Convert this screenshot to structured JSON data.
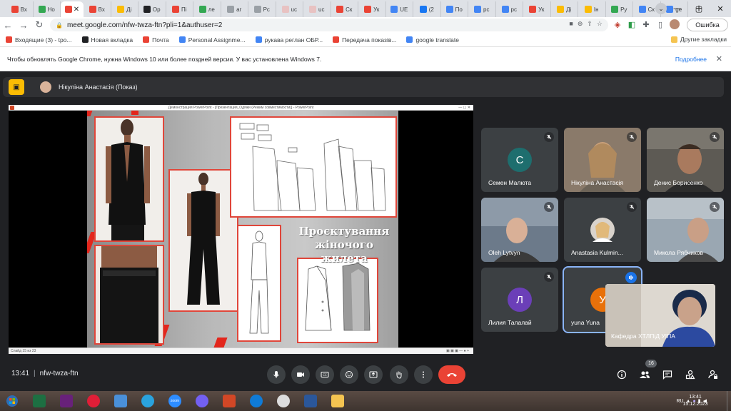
{
  "browser": {
    "tabs": [
      {
        "name": "gmail",
        "label": "Вх",
        "color": "#ea4335"
      },
      {
        "name": "ext",
        "label": "Но",
        "color": "#34a853"
      },
      {
        "name": "meet",
        "label": "",
        "color": "#ea4335",
        "active": true
      },
      {
        "name": "gmail2",
        "label": "Вх",
        "color": "#ea4335"
      },
      {
        "name": "gallery",
        "label": "Ді",
        "color": "#fbbc04"
      },
      {
        "name": "chrome",
        "label": "Ор",
        "color": "#202124"
      },
      {
        "name": "plus",
        "label": "Пі",
        "color": "#ea4335"
      },
      {
        "name": "lens",
        "label": "ле",
        "color": "#34a853"
      },
      {
        "name": "web",
        "label": "аг",
        "color": "#9aa0a6"
      },
      {
        "name": "doc",
        "label": "Рс",
        "color": "#9aa0a6"
      },
      {
        "name": "uc",
        "label": "uc",
        "color": "#e8c2c2"
      },
      {
        "name": "uc2",
        "label": "uc",
        "color": "#e8c2c2"
      },
      {
        "name": "heart",
        "label": "Ск",
        "color": "#ea4335"
      },
      {
        "name": "yt",
        "label": "Ук",
        "color": "#ea4335"
      },
      {
        "name": "ut",
        "label": "UE",
        "color": "#4285f4"
      },
      {
        "name": "fb",
        "label": "(2",
        "color": "#1877f2"
      },
      {
        "name": "diamond",
        "label": "По",
        "color": "#4285f4"
      },
      {
        "name": "pc",
        "label": "рс",
        "color": "#4285f4"
      },
      {
        "name": "pc2",
        "label": "рс",
        "color": "#4285f4"
      },
      {
        "name": "ukr",
        "label": "Ук",
        "color": "#ea4335"
      },
      {
        "name": "di2",
        "label": "Ді",
        "color": "#fbbc04"
      },
      {
        "name": "in",
        "label": "Ін",
        "color": "#fbbc04"
      },
      {
        "name": "ru",
        "label": "Ру",
        "color": "#34a853"
      },
      {
        "name": "sk",
        "label": "Ск",
        "color": "#4285f4"
      },
      {
        "name": "google",
        "label": "ge",
        "color": "#4285f4"
      }
    ],
    "url": "meet.google.com/nfw-twza-ftn?pli=1&authuser=2",
    "profile_status": "Ошибка",
    "bookmarks": [
      {
        "label": "Входящие (3) - tpo...",
        "color": "#ea4335"
      },
      {
        "label": "Новая вкладка",
        "color": "#202124"
      },
      {
        "label": "Почта",
        "color": "#ea4335"
      },
      {
        "label": "Personal Assignme...",
        "color": "#4285f4"
      },
      {
        "label": "рукава реглан ОБР...",
        "color": "#4285f4"
      },
      {
        "label": "Передача показів...",
        "color": "#ea4335"
      },
      {
        "label": "google translate",
        "color": "#4285f4"
      }
    ],
    "other_bookmarks": "Другие закладки",
    "infobar_message": "Чтобы обновлять Google Chrome, нужна Windows 10 или более поздней версии. У вас установлена Windows 7.",
    "infobar_link": "Подробнее"
  },
  "meet": {
    "presenter": "Нікуліна Анастасія (Показ)",
    "powerpoint_title": "Демонстрация PowerPoint - [Презентация_Одяжи (Режим совместимости)] - PowerPoint",
    "slide_status": "Слайд 15 из 23",
    "slide_title_line1": "Проєктування",
    "slide_title_line2": "жіночого жилета",
    "participants": [
      {
        "name": "Семен Малюта",
        "letter": "С",
        "color": "#1e6e6e"
      },
      {
        "name": "Нікуліна Анастасія",
        "letter": "",
        "color": ""
      },
      {
        "name": "Денис Борисенко",
        "letter": "",
        "color": ""
      },
      {
        "name": "Oleh Lytvyn",
        "letter": "",
        "color": ""
      },
      {
        "name": "Anastasia Kulmin...",
        "letter": "",
        "color": ""
      },
      {
        "name": "Микола Рябчиков",
        "letter": "",
        "color": ""
      },
      {
        "name": "Лилия Талалай",
        "letter": "Л",
        "color": "#6b3fb8"
      },
      {
        "name": "yuna Yuna",
        "letter": "У",
        "color": "#e8710a"
      }
    ],
    "self_view_name": "Кафедра ХТЛПіД УІПА",
    "time": "13:41",
    "meeting_code": "nfw-twza-ftn",
    "participants_count": "16"
  },
  "taskbar": {
    "lang": "RU",
    "time": "13:41",
    "date": "15.12.2023",
    "apps": [
      {
        "name": "excel-app",
        "label": "",
        "color": "#1d6f42"
      },
      {
        "name": "visual-studio-app",
        "label": "",
        "color": "#68217a"
      },
      {
        "name": "opera-app",
        "label": "",
        "color": "#e01e37"
      },
      {
        "name": "file-app",
        "label": "",
        "color": "#4a90d9"
      },
      {
        "name": "telegram-app",
        "label": "",
        "color": "#2aa3de"
      },
      {
        "name": "zoom-app",
        "label": "zoom",
        "color": "#2d8cff"
      },
      {
        "name": "viber-app",
        "label": "",
        "color": "#7360f2"
      },
      {
        "name": "powerpoint-app",
        "label": "",
        "color": "#d24726"
      },
      {
        "name": "edge-app",
        "label": "",
        "color": "#0f7bd7"
      },
      {
        "name": "chrome-app",
        "label": "",
        "color": "#dddddd"
      },
      {
        "name": "word-app",
        "label": "",
        "color": "#2b579a"
      },
      {
        "name": "explorer-app",
        "label": "",
        "color": "#f5c451"
      }
    ]
  }
}
